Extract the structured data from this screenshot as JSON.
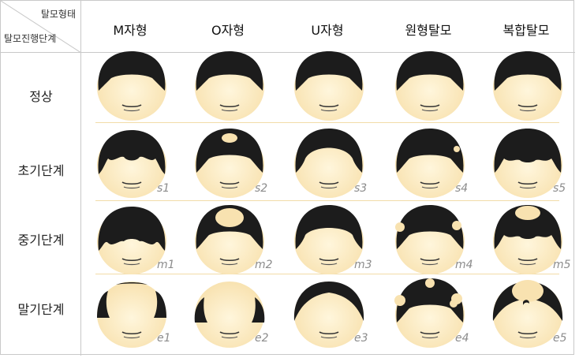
{
  "header": {
    "corner_top": "탈모형태",
    "corner_bottom": "탈모진행단계",
    "columns": [
      "M자형",
      "O자형",
      "U자형",
      "원형탈모",
      "복합탈모"
    ]
  },
  "rows": [
    {
      "label": "정상",
      "codes": [
        "",
        "",
        "",
        "",
        ""
      ]
    },
    {
      "label": "초기단계",
      "codes": [
        "s1",
        "s2",
        "s3",
        "s4",
        "s5"
      ]
    },
    {
      "label": "중기단계",
      "codes": [
        "m1",
        "m2",
        "m3",
        "m4",
        "m5"
      ]
    },
    {
      "label": "말기단계",
      "codes": [
        "e1",
        "e2",
        "e3",
        "e4",
        "e5"
      ]
    }
  ],
  "colors": {
    "hair": "#1c1c1c",
    "skin": "#f8e2b0",
    "skin_highlight": "#fff6dc",
    "separator": "#f2dca8",
    "code_text": "#8c8c8c"
  }
}
